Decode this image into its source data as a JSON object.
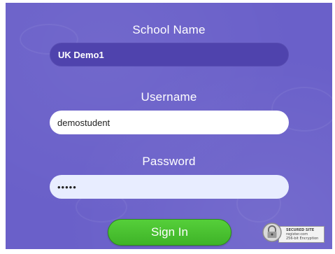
{
  "school": {
    "label": "School Name",
    "value": "UK Demo1"
  },
  "username": {
    "label": "Username",
    "value": "demostudent"
  },
  "password": {
    "label": "Password",
    "masked_value": "•••••"
  },
  "signin": {
    "label": "Sign In"
  },
  "seal": {
    "line1": "SECURED SITE",
    "line2": "register.com",
    "line3": "256-bit Encryption"
  },
  "colors": {
    "panel_bg": "#6a60c9",
    "school_field_bg": "#4f43ad",
    "signin_green": "#4cc232"
  }
}
